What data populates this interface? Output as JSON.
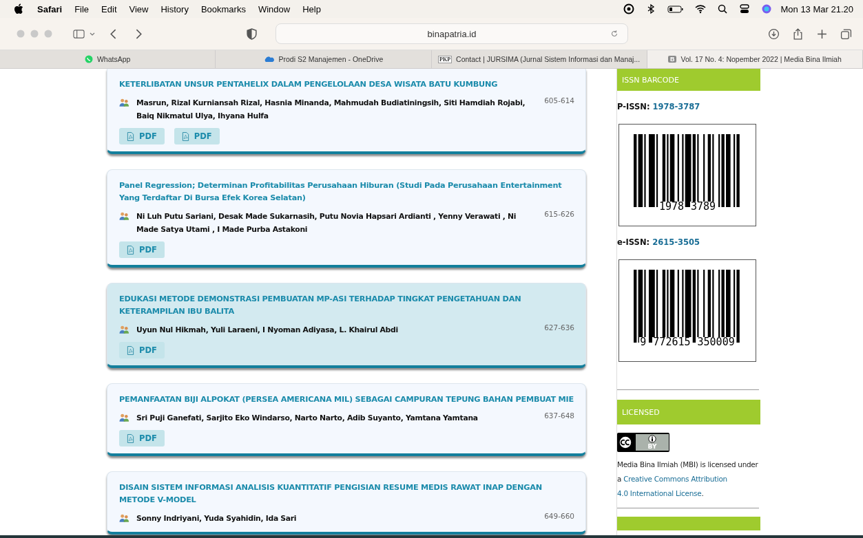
{
  "menu_bar": {
    "app": "Safari",
    "items": [
      "File",
      "Edit",
      "View",
      "History",
      "Bookmarks",
      "Window",
      "Help"
    ],
    "clock": "Mon 13 Mar 21.20"
  },
  "toolbar": {
    "address": "binapatria.id"
  },
  "tabs": [
    {
      "label": "WhatsApp",
      "selected": false
    },
    {
      "label": "Prodi S2 Manajemen - OneDrive",
      "selected": false
    },
    {
      "label": "Contact | JURSIMA (Jurnal Sistem Informasi dan Manaj...",
      "favicon_text": "PKP",
      "selected": false
    },
    {
      "label": "Vol. 17 No. 4: Nopember 2022 | Media Bina Ilmiah",
      "favicon_text": "B",
      "selected": true
    }
  ],
  "articles": [
    {
      "title": "KETERLIBATAN UNSUR PENTAHELIX DALAM PENGELOLAAN DESA WISATA BATU KUMBUNG",
      "authors": "Masrun, Rizal Kurniansah Rizal, Hasnia Minanda, Mahmudah Budiatiningsih, Siti Hamdiah Rojabi, Baiq Nikmatul Ulya, Ihyana Hulfa",
      "pages": "605-614",
      "buttons": [
        "PDF",
        "PDF"
      ],
      "highlighted": false
    },
    {
      "title": "Panel Regression; Determinan Profitabilitas Perusahaan Hiburan (Studi Pada Perusahaan Entertainment Yang Terdaftar Di Bursa Efek Korea Selatan)",
      "authors": "Ni Luh Putu Sariani, Desak Made Sukarnasih, Putu Novia Hapsari Ardianti , Yenny Verawati , Ni Made Satya Utami , I Made Purba Astakoni",
      "pages": "615-626",
      "buttons": [
        "PDF"
      ],
      "highlighted": false
    },
    {
      "title": "EDUKASI METODE DEMONSTRASI PEMBUATAN MP-ASI TERHADAP TINGKAT PENGETAHUAN DAN KETERAMPILAN IBU BALITA",
      "authors": "Uyun Nul Hikmah, Yuli Laraeni, I Nyoman Adiyasa, L. Khairul Abdi",
      "pages": "627-636",
      "buttons": [
        "PDF"
      ],
      "highlighted": true
    },
    {
      "title": "PEMANFAATAN BIJI ALPOKAT (PERSEA AMERICANA MIL) SEBAGAI CAMPURAN TEPUNG BAHAN PEMBUAT MIE",
      "authors": "Sri Puji Ganefati, Sarjito Eko Windarso, Narto Narto, Adib Suyanto, Yamtana Yamtana",
      "pages": "637-648",
      "buttons": [
        "PDF"
      ],
      "highlighted": false
    },
    {
      "title": "DISAIN SISTEM INFORMASI ANALISIS KUANTITATIF PENGISIAN RESUME MEDIS RAWAT INAP DENGAN METODE V-MODEL",
      "authors": "Sonny Indriyani, Yuda Syahidin, Ida Sari",
      "pages": "649-660",
      "highlighted": false
    }
  ],
  "sidebar": {
    "issn_heading": "ISSN BARCODE",
    "issns": [
      {
        "label": "P-ISSN:",
        "number": "1978-3787",
        "barcode_digits": [
          "1978",
          "3789"
        ]
      },
      {
        "label": "e-ISSN:",
        "number": "2615-3505",
        "barcode_digits": [
          "9",
          "772615",
          "350009"
        ]
      }
    ],
    "license_heading": "LICENSED",
    "license_badge": "BY",
    "license_text": "Media Bina Ilmiah (MBI) is licensed under a",
    "license_link": [
      "Creative Commons Attribution",
      "4.0 International License"
    ],
    "license_end": "."
  }
}
